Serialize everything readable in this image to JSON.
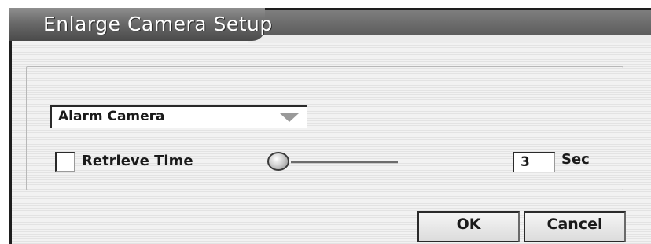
{
  "dialog": {
    "title": "Enlarge Camera Setup"
  },
  "camera_select": {
    "selected": "Alarm Camera"
  },
  "retrieve_time": {
    "checkbox_label": "Retrieve Time",
    "checked": false,
    "slider_level": 0.0,
    "value": "3",
    "unit": "Sec"
  },
  "buttons": {
    "ok": "OK",
    "cancel": "Cancel"
  },
  "icons": {
    "dropdown": "chevron-down-icon"
  }
}
